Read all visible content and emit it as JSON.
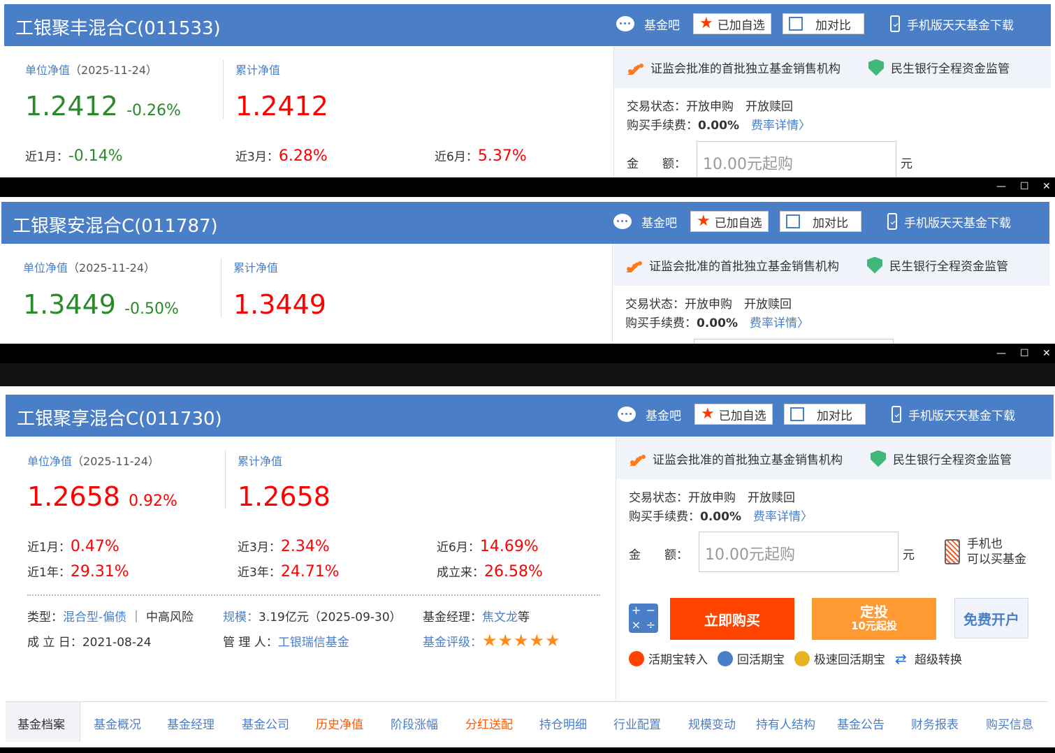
{
  "header_buttons": {
    "fund_bar": "基金吧",
    "added_watchlist": "已加自选",
    "add_compare": "加对比",
    "mobile_download": "手机版天天基金下载"
  },
  "certs": {
    "csrc": "证监会批准的首批独立基金销售机构",
    "bank": "民生银行全程资金监管"
  },
  "labels": {
    "unit_nav": "单位净值",
    "cum_nav": "累计净值",
    "trade_status_k": "交易状态：",
    "open_buy": "开放申购",
    "open_redeem": "开放赎回",
    "fee_k": "购买手续费：",
    "fee_detail": "费率详情〉",
    "amount_k": "金　　额：",
    "amount_placeholder": "10.00元起购",
    "yuan": "元",
    "phone_buy_1": "手机也",
    "phone_buy_2": "可以买基金",
    "m1": "近1月：",
    "m3": "近3月：",
    "m6": "近6月：",
    "y1": "近1年：",
    "y3": "近3年：",
    "since": "成立来："
  },
  "window_controls": [
    "—",
    "☐",
    "✕"
  ],
  "funds": [
    {
      "title": "工银聚丰混合C(011533)",
      "date": "（2025-11-24）",
      "unit_nav": "1.2412",
      "change": "-0.26%",
      "cum_nav": "1.2412",
      "fee": "0.00%",
      "m1": "-0.14%",
      "m3": "6.28%",
      "m6": "5.37%"
    },
    {
      "title": "工银聚安混合C(011787)",
      "date": "（2025-11-24）",
      "unit_nav": "1.3449",
      "change": "-0.50%",
      "cum_nav": "1.3449",
      "fee": "0.00%"
    },
    {
      "title": "工银聚享混合C(011730)",
      "date": "（2025-11-24）",
      "unit_nav": "1.2658",
      "change": "0.92%",
      "cum_nav": "1.2658",
      "fee": "0.00%",
      "m1": "0.47%",
      "m3": "2.34%",
      "m6": "14.69%",
      "y1": "29.31%",
      "y3": "24.71%",
      "since": "26.58%",
      "type_k": "类型：",
      "type_v": "混合型-偏债",
      "risk": "中高风险",
      "scale_k": "规模：",
      "scale_v": "3.19亿元（2025-09-30）",
      "manager_k": "基金经理：",
      "manager_v": "焦文龙",
      "manager_suffix": "等",
      "inception_k": "成 立 日：",
      "inception_v": "2021-08-24",
      "admin_k": "管 理 人：",
      "admin_v": "工银瑞信基金",
      "rating_k": "基金评级：",
      "rating_stars": 5
    }
  ],
  "actions": {
    "buy": "立即购买",
    "dingtou": "定投",
    "dingtou_sub": "10元起投",
    "open_account": "免费开户",
    "links": [
      "活期宝转入",
      "回活期宝",
      "极速回活期宝",
      "超级转换"
    ]
  },
  "nav_tabs": [
    "基金档案",
    "基金概况",
    "基金经理",
    "基金公司",
    "历史净值",
    "阶段涨幅",
    "分红送配",
    "持仓明细",
    "行业配置",
    "规模变动",
    "持有人结构",
    "基金公告",
    "财务报表",
    "购买信息"
  ],
  "colors": {
    "header_blue": "#4a7fc7",
    "up_red": "#ff0000",
    "down_green": "#2a8a2a",
    "buy_orange": "#ff4400",
    "dingtou_orange": "#ff9a33"
  }
}
